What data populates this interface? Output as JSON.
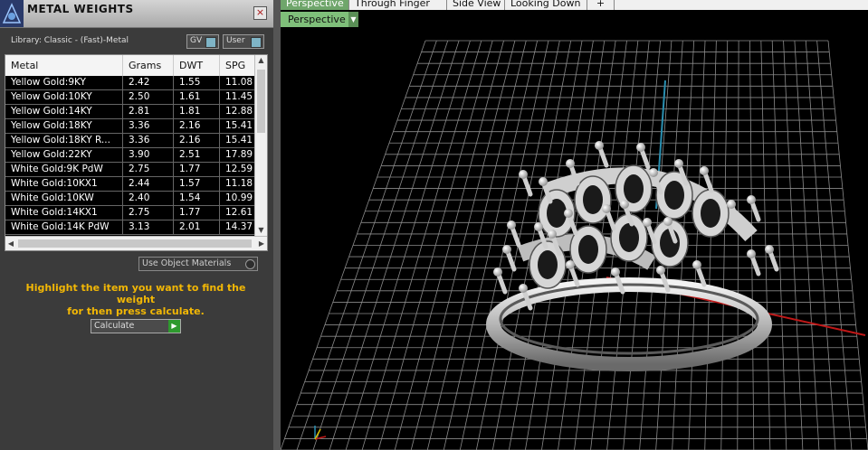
{
  "panel": {
    "title": "METAL WEIGHTS",
    "close_glyph": "×",
    "library_label": "Library: Classic - (Fast)-Metal",
    "gv_label": "GV",
    "user_label": "User",
    "use_object_materials": "Use Object Materials",
    "instructions_line1": "Highlight the item you want to find the weight",
    "instructions_line2": "for then press calculate.",
    "calculate_label": "Calculate"
  },
  "table": {
    "headers": [
      "Metal",
      "Grams",
      "DWT",
      "SPG"
    ],
    "rows": [
      {
        "metal": "Yellow Gold:9KY",
        "grams": "2.42",
        "dwt": "1.55",
        "spg": "11.08"
      },
      {
        "metal": "Yellow Gold:10KY",
        "grams": "2.50",
        "dwt": "1.61",
        "spg": "11.45"
      },
      {
        "metal": "Yellow Gold:14KY",
        "grams": "2.81",
        "dwt": "1.81",
        "spg": "12.88"
      },
      {
        "metal": "Yellow Gold:18KY",
        "grams": "3.36",
        "dwt": "2.16",
        "spg": "15.41"
      },
      {
        "metal": "Yellow Gold:18KY R...",
        "grams": "3.36",
        "dwt": "2.16",
        "spg": "15.41"
      },
      {
        "metal": "Yellow Gold:22KY",
        "grams": "3.90",
        "dwt": "2.51",
        "spg": "17.89"
      },
      {
        "metal": "White Gold:9K PdW",
        "grams": "2.75",
        "dwt": "1.77",
        "spg": "12.59"
      },
      {
        "metal": "White Gold:10KX1",
        "grams": "2.44",
        "dwt": "1.57",
        "spg": "11.18"
      },
      {
        "metal": "White Gold:10KW",
        "grams": "2.40",
        "dwt": "1.54",
        "spg": "10.99"
      },
      {
        "metal": "White Gold:14KX1",
        "grams": "2.75",
        "dwt": "1.77",
        "spg": "12.61"
      },
      {
        "metal": "White Gold:14K PdW",
        "grams": "3.13",
        "dwt": "2.01",
        "spg": "14.37"
      }
    ]
  },
  "tabs": [
    {
      "label": "Perspective",
      "active": true
    },
    {
      "label": "Through Finger",
      "active": false
    },
    {
      "label": "Side View",
      "active": false
    },
    {
      "label": "Looking Down",
      "active": false
    },
    {
      "label": "+",
      "active": false
    }
  ],
  "view_select": "Perspective",
  "icons": {
    "app_logo": "tripod-logo-icon",
    "close": "close-icon",
    "calc_arrow": "play-arrow-icon",
    "dropdown": "chevron-down-icon"
  },
  "colors": {
    "accent_green": "#7fbf7a",
    "instruction_text": "#f2b705",
    "axis_x": "#c01818",
    "axis_y": "#2a8fb0"
  }
}
